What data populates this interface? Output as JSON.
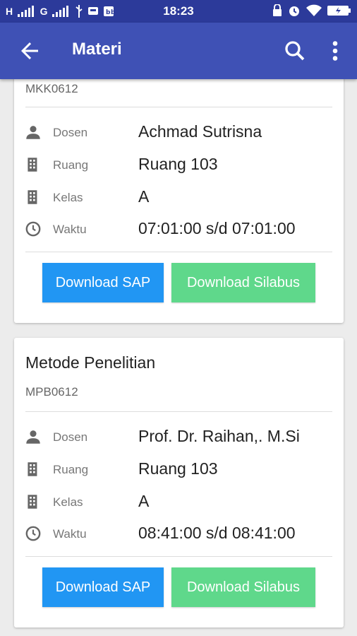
{
  "status_bar": {
    "time": "18:23",
    "signal_left": "H",
    "signal_mid": "G"
  },
  "app_bar": {
    "title": "Materi"
  },
  "card_labels": {
    "dosen": "Dosen",
    "ruang": "Ruang",
    "kelas": "Kelas",
    "waktu": "Waktu"
  },
  "courses": [
    {
      "title": "",
      "code": "MKK0612",
      "dosen": "Achmad Sutrisna",
      "ruang": "Ruang 103",
      "kelas": "A",
      "waktu": "07:01:00 s/d 07:01:00",
      "btn_sap": "Download SAP",
      "btn_silabus": "Download Silabus"
    },
    {
      "title": "Metode Penelitian",
      "code": "MPB0612",
      "dosen": "Prof. Dr. Raihan,. M.Si",
      "ruang": "Ruang 103",
      "kelas": "A",
      "waktu": "08:41:00 s/d 08:41:00",
      "btn_sap": "Download SAP",
      "btn_silabus": "Download Silabus"
    }
  ],
  "colors": {
    "primary": "#3f51b5",
    "status_bar": "#2c3a9a",
    "btn_sap": "#2196f3",
    "btn_silabus": "#5fd88b"
  }
}
